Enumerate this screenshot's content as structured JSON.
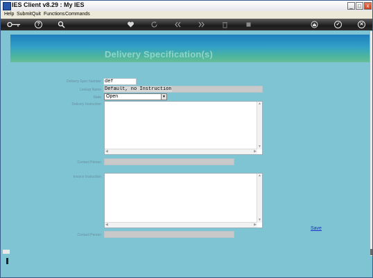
{
  "window": {
    "title": "IES Client v8.29 : My IES"
  },
  "window_controls": {
    "minimize": "_",
    "maximize": "□",
    "close": "x"
  },
  "menu": [
    "Help",
    "Submit",
    "Quit",
    "Functions",
    "Commands"
  ],
  "toolbar": {
    "icons": [
      "key-icon",
      "help-icon",
      "search-icon",
      "heart-icon",
      "refresh-icon",
      "rewind-icon",
      "forward-icon",
      "trash-icon",
      "stop-icon",
      "home-icon",
      "check-icon",
      "close-icon"
    ],
    "help_glyph": "?",
    "check_glyph": "✓",
    "close_glyph": "✕"
  },
  "page": {
    "title": "Delivery Specification(s)"
  },
  "form": {
    "spec_number_label": "Delivery Spec Number",
    "spec_number_value": "def",
    "lookup_label": "Lookup Name",
    "lookup_value": "Default, no Instruction",
    "state_label": "State",
    "state_value": "Open",
    "delivery_instruction_label": "Delivery Instruction",
    "delivery_instruction_value": "",
    "contact_person_label": "Contact Person",
    "contact_person_value": "",
    "invoice_instruction_label": "Invoice Instruction",
    "invoice_instruction_value": "",
    "contact_person2_label": "Contact Person",
    "contact_person2_value": "",
    "save_label": "Save"
  },
  "colors": {
    "background": "#7ec4d3",
    "banner_start": "#1e7fbc",
    "banner_end": "#66bd9a",
    "title_text": "#8fd5c8",
    "link": "#1a2fcc"
  }
}
